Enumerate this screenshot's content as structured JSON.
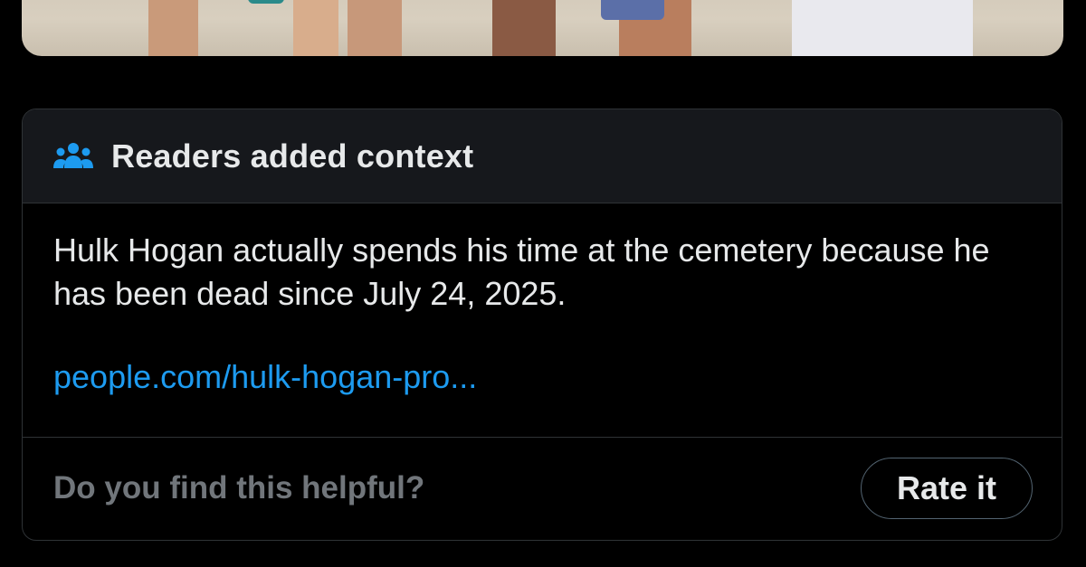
{
  "note": {
    "header_title": "Readers added context",
    "header_icon": "people-icon",
    "body_text": "Hulk Hogan actually spends his time at the cemetery because he has been dead since July 24, 2025.",
    "link_text": "people.com/hulk-hogan-pro...",
    "helpful_question": "Do you find this helpful?",
    "rate_button_label": "Rate it"
  },
  "colors": {
    "background": "#000000",
    "header_bg": "#16181c",
    "border": "#2f3336",
    "text": "#e7e9ea",
    "muted": "#71767b",
    "link": "#1d9bf0",
    "icon": "#1d9bf0"
  }
}
